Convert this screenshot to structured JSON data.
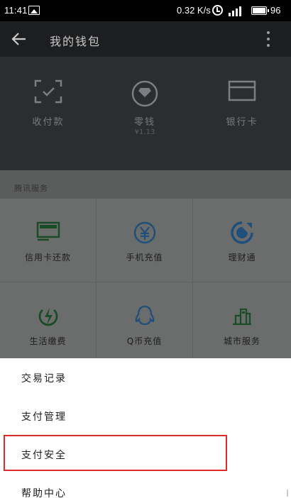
{
  "status_bar": {
    "time": "11:41",
    "speed": "0.32 K/s",
    "battery": "96",
    "icons": [
      "image-icon",
      "alarm-icon",
      "signal-icon",
      "battery-icon"
    ]
  },
  "app_bar": {
    "title": "我的钱包",
    "icons": [
      "back-arrow-icon",
      "more-vert-icon"
    ]
  },
  "wallet": {
    "items": [
      {
        "label": "收付款",
        "sub": "",
        "icon": "scan-icon"
      },
      {
        "label": "零钱",
        "sub": "¥1.13",
        "icon": "coin-icon"
      },
      {
        "label": "银行卡",
        "sub": "",
        "icon": "card-icon"
      }
    ]
  },
  "services": {
    "header": "腾讯服务",
    "items": [
      {
        "label": "信用卡还款",
        "icon": "credit-card-icon"
      },
      {
        "label": "手机充值",
        "icon": "yuan-icon"
      },
      {
        "label": "理财通",
        "icon": "wealth-icon"
      },
      {
        "label": "生活缴费",
        "icon": "lightning-icon"
      },
      {
        "label": "Q币充值",
        "icon": "penguin-icon"
      },
      {
        "label": "城市服务",
        "icon": "city-icon"
      }
    ]
  },
  "menu": {
    "items": [
      {
        "label": "交易记录"
      },
      {
        "label": "支付管理"
      },
      {
        "label": "支付安全"
      },
      {
        "label": "帮助中心"
      }
    ]
  },
  "colors": {
    "dark_bar": "#1d1e20",
    "wallet_bg": "#2b2e31",
    "overlay_gray": "#6b6c6c",
    "icon_green": "#1a4d27",
    "icon_blue": "#1f4f7a",
    "highlight_red": "#e02a2a"
  }
}
